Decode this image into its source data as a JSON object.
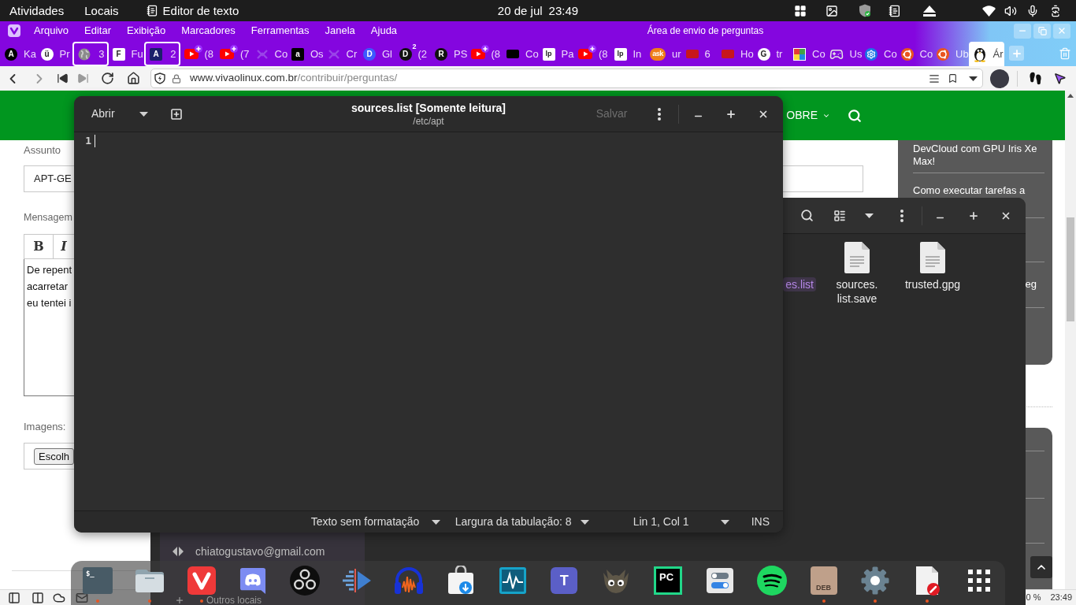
{
  "top_bar": {
    "activities": "Atividades",
    "places": "Locais",
    "app": "Editor de texto",
    "date": "20 de jul",
    "time": "23:49"
  },
  "browser": {
    "menu": [
      "Arquivo",
      "Editar",
      "Exibição",
      "Marcadores",
      "Ferramentas",
      "Janela",
      "Ajuda"
    ],
    "window_title": "Área de envio de perguntas",
    "tabs": [
      {
        "title": "Ka",
        "kind": "disc",
        "glyph": "A",
        "color": "#000000",
        "stacked": false,
        "notification": false,
        "selected": false
      },
      {
        "title": "Pr",
        "kind": "disc",
        "glyph": "ü",
        "color": "#ffffff",
        "stacked": false,
        "notification": false,
        "selected": false
      },
      {
        "title": "3",
        "kind": "globe",
        "stacked": true,
        "notification": false,
        "selected": false
      },
      {
        "title": "Fu",
        "kind": "tile",
        "glyph": "F",
        "color": "#ffffff",
        "stacked": false,
        "notification": false,
        "selected": false
      },
      {
        "title": "2",
        "kind": "tile",
        "glyph": "A",
        "color": "#1b1f6b",
        "stacked": true,
        "notification": false,
        "selected": false
      },
      {
        "title": "(8",
        "kind": "video",
        "stacked": false,
        "notification": true,
        "selected": false
      },
      {
        "title": "(7",
        "kind": "video",
        "stacked": false,
        "notification": true,
        "selected": false
      },
      {
        "title": "Co",
        "kind": "cross",
        "stacked": false,
        "notification": false,
        "selected": false
      },
      {
        "title": "Os",
        "kind": "tile",
        "glyph": "a",
        "color": "#000000",
        "stacked": false,
        "notification": false,
        "selected": false
      },
      {
        "title": "Cr",
        "kind": "cross",
        "stacked": false,
        "notification": false,
        "selected": false
      },
      {
        "title": "Gl",
        "kind": "disc",
        "glyph": "D",
        "color": "#3d5afe",
        "stacked": false,
        "notification": false,
        "selected": false
      },
      {
        "title": "(2",
        "kind": "disc",
        "glyph": "D",
        "color": "#111111",
        "badge": "2",
        "stacked": false,
        "notification": false,
        "selected": false
      },
      {
        "title": "PS",
        "kind": "disc",
        "glyph": "R",
        "color": "#111111",
        "stacked": false,
        "notification": false,
        "selected": false
      },
      {
        "title": "(8",
        "kind": "video",
        "stacked": false,
        "notification": true,
        "selected": false
      },
      {
        "title": "Co",
        "kind": "tile",
        "color": "#000000",
        "stacked": false,
        "notification": false,
        "selected": false
      },
      {
        "title": "Pa",
        "kind": "tile",
        "glyph": "lp",
        "color": "#ffffff",
        "stacked": false,
        "notification": false,
        "selected": false
      },
      {
        "title": "(8",
        "kind": "video",
        "stacked": false,
        "notification": true,
        "selected": false
      },
      {
        "title": "In",
        "kind": "tile",
        "glyph": "lp",
        "color": "#ffffff",
        "stacked": false,
        "notification": false,
        "selected": false
      },
      {
        "title": "ur",
        "kind": "disc",
        "glyph": "ask",
        "color": "#ef7d1a",
        "stacked": false,
        "notification": false,
        "selected": false
      },
      {
        "title": "6",
        "kind": "tile",
        "color": "#c8161d",
        "stacked": false,
        "notification": false,
        "selected": false
      },
      {
        "title": "Ho",
        "kind": "tile",
        "color": "#c8161d",
        "stacked": false,
        "notification": false,
        "selected": false
      },
      {
        "title": "tr",
        "kind": "disc",
        "glyph": "G",
        "color": "#ffffff",
        "stacked": false,
        "notification": false,
        "selected": false
      },
      {
        "title": "Co",
        "kind": "mosaic",
        "stacked": false,
        "notification": false,
        "selected": false
      },
      {
        "title": "Us",
        "kind": "gamepad",
        "stacked": false,
        "notification": false,
        "selected": false
      },
      {
        "title": "Co",
        "kind": "gear",
        "stacked": false,
        "notification": false,
        "selected": false
      },
      {
        "title": "Co",
        "kind": "ubuntu",
        "stacked": false,
        "notification": false,
        "selected": false
      },
      {
        "title": "Ub",
        "kind": "ubuntu",
        "stacked": false,
        "notification": false,
        "selected": false
      },
      {
        "title": "Ár",
        "kind": "penguin",
        "stacked": false,
        "notification": false,
        "selected": true
      }
    ],
    "address": {
      "host": "www.vivaolinux.com.br",
      "path": "/contribuir/perguntas/"
    },
    "page": {
      "nav_item": "OBRE",
      "subject_label": "Assunto",
      "subject_value": "APT-GE",
      "message_label": "Mensagem",
      "format_buttons": [
        {
          "kind": "bold",
          "label": "B"
        },
        {
          "kind": "italic",
          "label": "I"
        }
      ],
      "message_lines": [
        "De repent",
        "acarretar",
        "eu tentei i"
      ],
      "images_label": "Imagens:",
      "file_button": "Escolh",
      "sidebar": [
        "DevCloud com GPU Iris Xe Max!",
        "Como executar tarefas a",
        "eg"
      ]
    },
    "status_bar": {
      "zoom": "0 %",
      "time": "23:49"
    }
  },
  "file_manager": {
    "files": [
      {
        "label": [
          "es.list"
        ],
        "selected": true
      },
      {
        "label": [
          "sources.",
          "list.save"
        ],
        "selected": false
      },
      {
        "label": [
          "trusted.gpg"
        ],
        "selected": false
      }
    ],
    "places": [
      {
        "kind": "account",
        "label": "chiatogustavo@gmail.com"
      },
      {
        "kind": "add",
        "label": "Outros locais"
      }
    ]
  },
  "editor": {
    "open_button": "Abrir",
    "title": "sources.list [Somente leitura]",
    "path": "/etc/apt",
    "save_button": "Salvar",
    "save_disabled": true,
    "lines": [
      "1"
    ],
    "status": {
      "language": "Texto sem formatação",
      "tab_width": "Largura da tabulação: 8",
      "position": "Lin 1, Col 1",
      "mode": "INS"
    }
  },
  "dock": {
    "apps": [
      {
        "kind": "terminal",
        "glyph": "$_",
        "running": true
      },
      {
        "kind": "files",
        "running": true
      },
      {
        "kind": "vivaldi",
        "running": true
      },
      {
        "kind": "discord",
        "running": false
      },
      {
        "kind": "obs",
        "running": false
      },
      {
        "kind": "audio",
        "running": false
      },
      {
        "kind": "audacity",
        "running": false
      },
      {
        "kind": "software",
        "running": false
      },
      {
        "kind": "monitor",
        "running": false
      },
      {
        "kind": "teams",
        "glyph": "T",
        "running": false
      },
      {
        "kind": "gimp",
        "running": false
      },
      {
        "kind": "pycharm",
        "glyph": "PC",
        "running": false
      },
      {
        "kind": "tweaks",
        "running": false
      },
      {
        "kind": "spotify",
        "running": false
      },
      {
        "kind": "package",
        "glyph": "DEB",
        "running": true
      },
      {
        "kind": "settings",
        "running": true
      },
      {
        "kind": "editor",
        "running": true
      },
      {
        "kind": "grid",
        "running": false
      }
    ]
  }
}
